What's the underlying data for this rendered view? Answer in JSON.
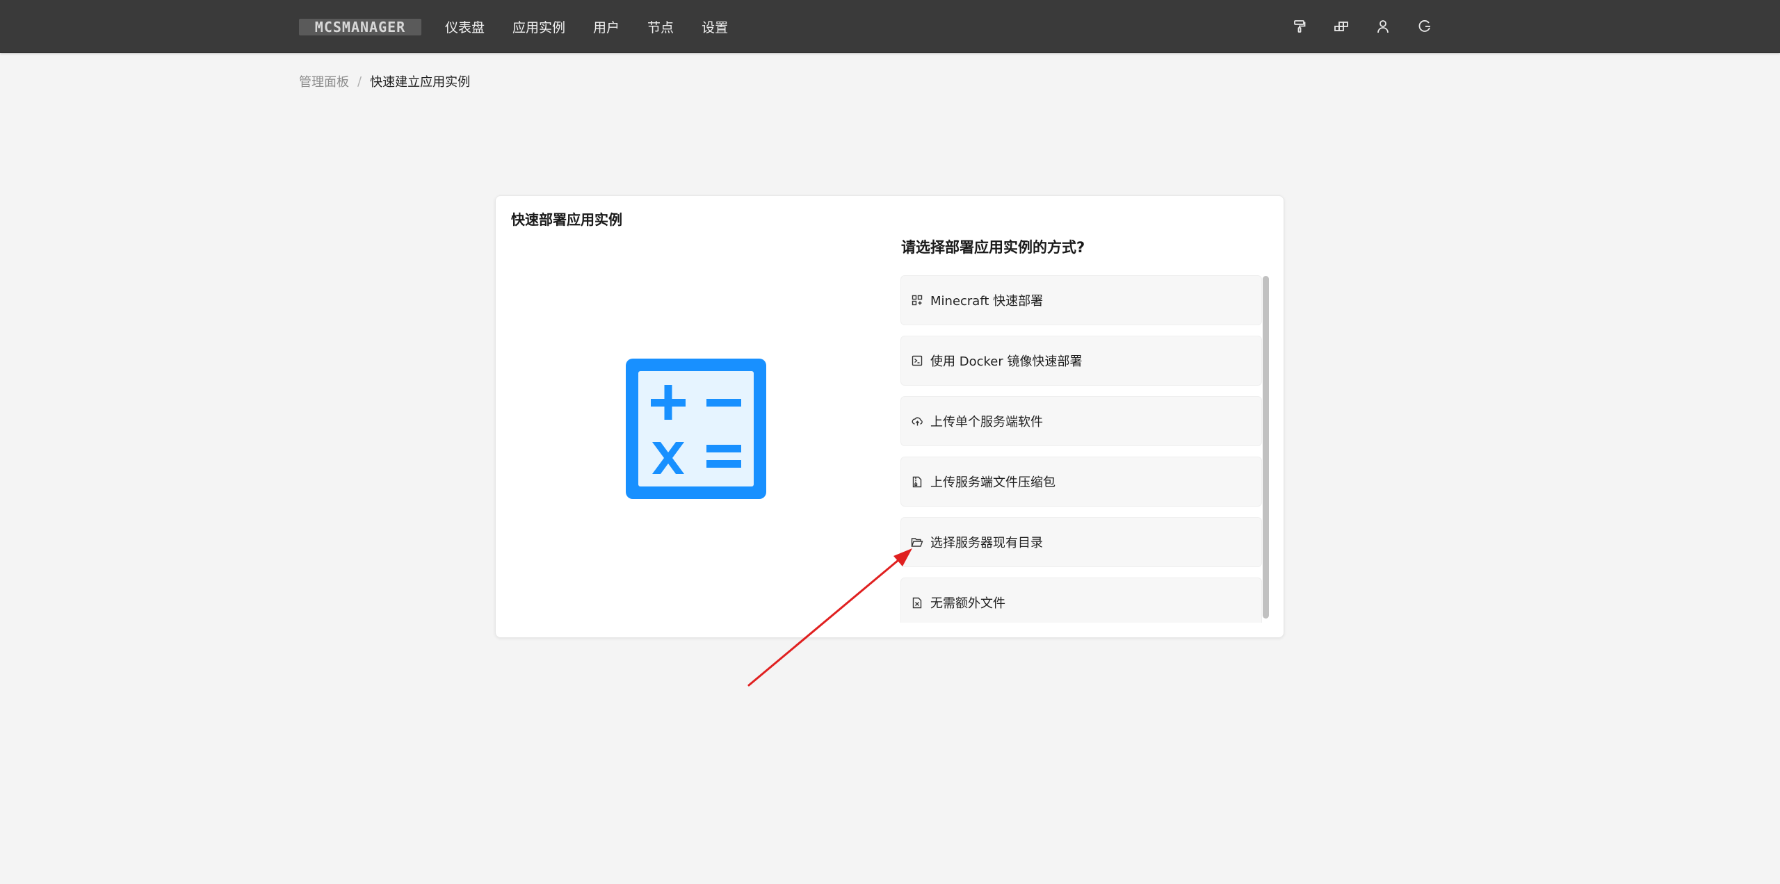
{
  "header": {
    "logo_text": "MCSMANAGER",
    "nav": [
      {
        "label": "仪表盘"
      },
      {
        "label": "应用实例"
      },
      {
        "label": "用户"
      },
      {
        "label": "节点"
      },
      {
        "label": "设置"
      }
    ],
    "actions": [
      "paint-roller-icon",
      "nodes-icon",
      "user-icon",
      "logout-icon"
    ]
  },
  "breadcrumb": {
    "parent": "管理面板",
    "separator": "/",
    "current": "快速建立应用实例"
  },
  "card": {
    "title": "快速部署应用实例",
    "illustration_icon": "calculator-icon",
    "question": "请选择部署应用实例的方式?",
    "options": [
      {
        "label": "Minecraft 快速部署",
        "icon": "appstore-icon"
      },
      {
        "label": "使用 Docker 镜像快速部署",
        "icon": "terminal-icon"
      },
      {
        "label": "上传单个服务端软件",
        "icon": "cloud-upload-icon"
      },
      {
        "label": "上传服务端文件压缩包",
        "icon": "file-zip-icon"
      },
      {
        "label": "选择服务器现有目录",
        "icon": "folder-open-icon"
      },
      {
        "label": "无需额外文件",
        "icon": "file-excel-icon"
      }
    ]
  },
  "colors": {
    "topbar": "#3a3a3a",
    "page_bg": "#f4f4f4",
    "accent_blue": "#1890ff",
    "annotation_red": "#e02020"
  }
}
